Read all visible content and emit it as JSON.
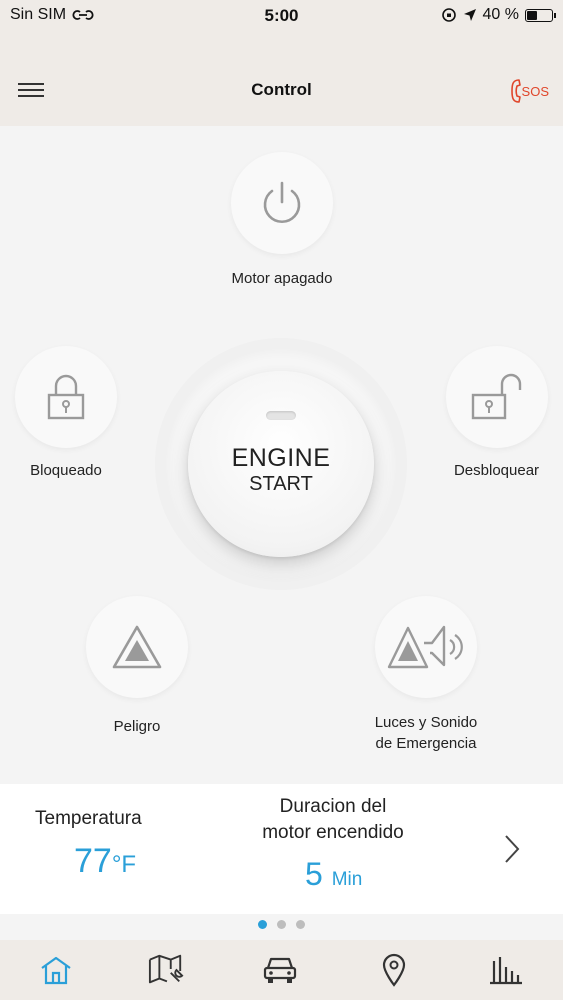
{
  "status_bar": {
    "carrier": "Sin SIM",
    "time": "5:00",
    "battery_text": "40 %",
    "battery_level": 0.4
  },
  "header": {
    "title": "Control",
    "sos_label": "SOS"
  },
  "controls": {
    "engine_status": "Motor apagado",
    "lock": "Bloqueado",
    "unlock": "Desbloquear",
    "hazard": "Peligro",
    "lights_sound_line1": "Luces y Sonido",
    "lights_sound_line2": "de Emergencia"
  },
  "engine_button": {
    "line1": "ENGINE",
    "line2": "START"
  },
  "info": {
    "temperature_label": "Temperatura",
    "temperature_value": "77",
    "temperature_unit": "°F",
    "duration_label_line1": "Duracion del",
    "duration_label_line2": "motor encendido",
    "duration_value": "5",
    "duration_unit": "Min"
  },
  "pagination": {
    "total": 3,
    "active": 1
  },
  "tabs": [
    "home-icon",
    "map-service-icon",
    "car-icon",
    "location-pin-icon",
    "stats-icon"
  ],
  "colors": {
    "accent": "#2a9fd8",
    "sos": "#e0462b",
    "icon_gray": "#9a9a9a"
  }
}
